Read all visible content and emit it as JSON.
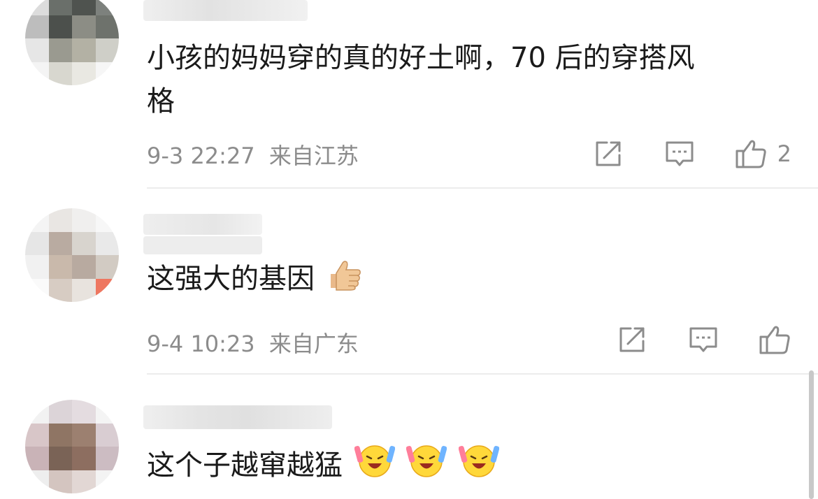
{
  "comments": [
    {
      "text_line1": "小孩的妈妈穿的真的好土啊，70 后的穿搭风",
      "text_line2": "格",
      "time": "9-3 22:27",
      "location": "来自江苏",
      "like_count": "2"
    },
    {
      "text": "这强大的基因",
      "time": "9-4 10:23",
      "location": "来自广东",
      "like_count": ""
    },
    {
      "text": "这个子越窜越猛"
    }
  ],
  "icons": {
    "share": "share-icon",
    "comment": "comment-icon",
    "like": "like-icon",
    "thumbs_up_emoji": "thumbs-up-emoji",
    "laughing_emoji": "laughing-cheering-emoji"
  },
  "colors": {
    "meta_text": "#8c8c8c",
    "divider": "#ececec"
  }
}
